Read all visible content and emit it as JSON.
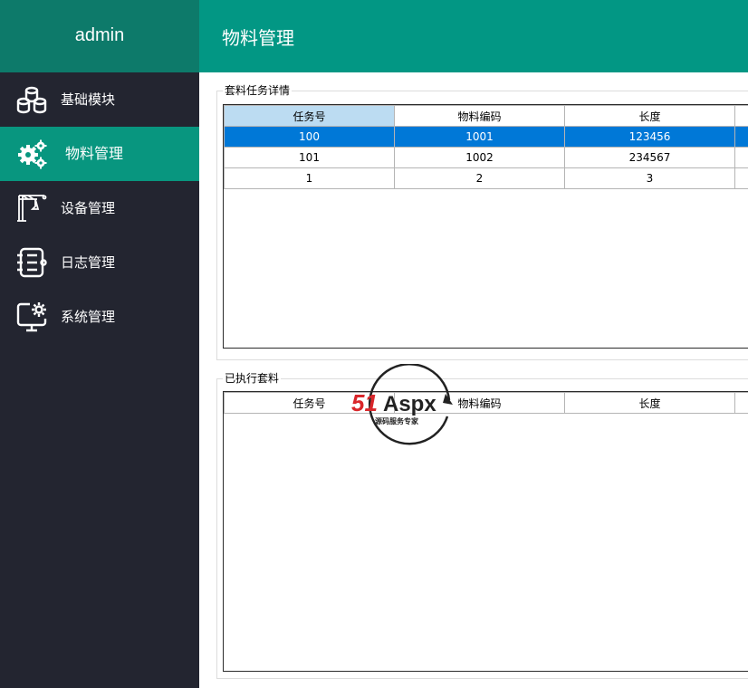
{
  "app": {
    "user": "admin"
  },
  "sidebar": {
    "items": [
      {
        "label": "基础模块",
        "icon": "database-icon"
      },
      {
        "label": "物料管理",
        "icon": "gears-icon",
        "active": true
      },
      {
        "label": "设备管理",
        "icon": "crane-icon"
      },
      {
        "label": "日志管理",
        "icon": "notebook-icon"
      },
      {
        "label": "系统管理",
        "icon": "monitor-settings-icon"
      }
    ]
  },
  "header": {
    "title": "物料管理"
  },
  "task_panel": {
    "title": "套料任务详情",
    "columns": [
      "任务号",
      "物料编码",
      "长度"
    ],
    "rows": [
      [
        "100",
        "1001",
        "123456"
      ],
      [
        "101",
        "1002",
        "234567"
      ],
      [
        "1",
        "2",
        "3"
      ]
    ]
  },
  "executed_panel": {
    "title": "已执行套料",
    "columns": [
      "任务号",
      "物料编码",
      "长度"
    ]
  },
  "watermark": {
    "brand": "51Aspx",
    "tagline": "源码服务专家"
  },
  "colors": {
    "accent": "#029784",
    "sidebar": "#232530",
    "selection": "#0078d7"
  }
}
